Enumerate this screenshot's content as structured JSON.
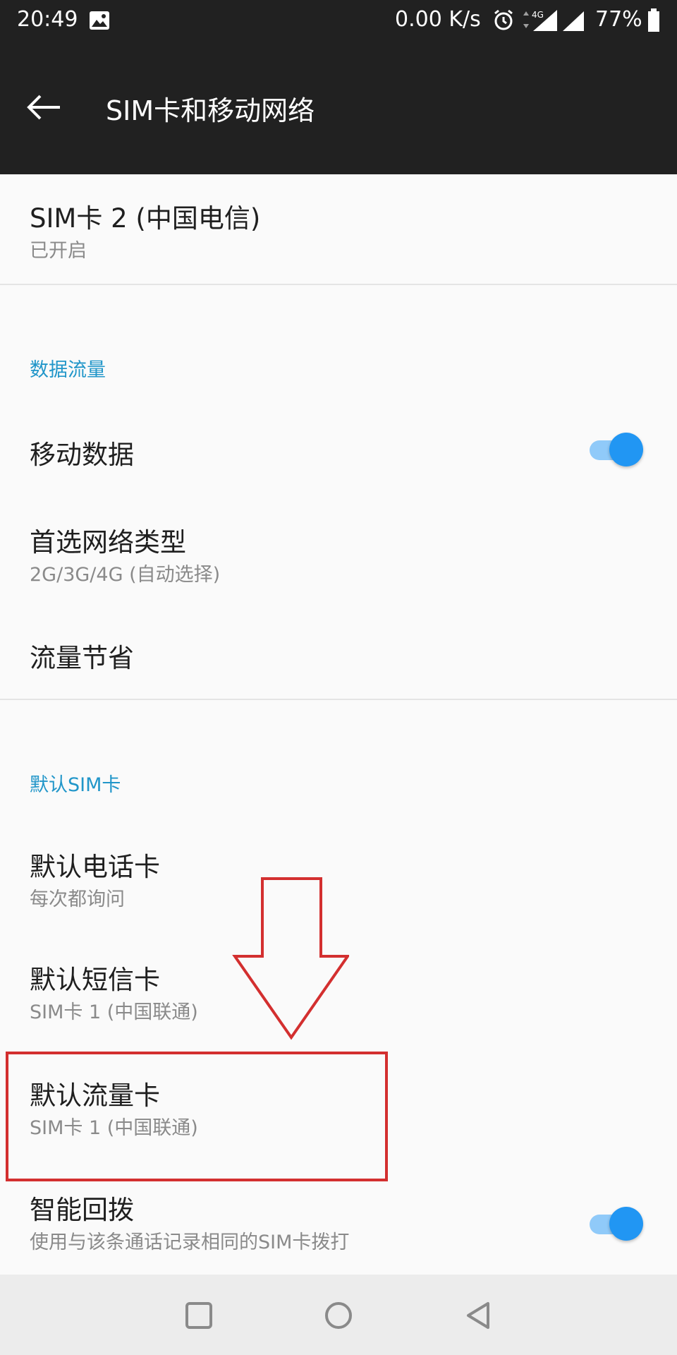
{
  "status_bar": {
    "time": "20:49",
    "speed": "0.00 K/s",
    "network_type": "4G",
    "battery": "77%"
  },
  "toolbar": {
    "title": "SIM卡和移动网络"
  },
  "sim2": {
    "title": "SIM卡 2 (中国电信)",
    "status": "已开启"
  },
  "data_section": {
    "header": "数据流量",
    "mobile_data": {
      "label": "移动数据",
      "enabled": true
    },
    "preferred_network": {
      "label": "首选网络类型",
      "value": "2G/3G/4G (自动选择)"
    },
    "data_saver": {
      "label": "流量节省"
    }
  },
  "default_sim_section": {
    "header": "默认SIM卡",
    "call_card": {
      "label": "默认电话卡",
      "value": "每次都询问"
    },
    "sms_card": {
      "label": "默认短信卡",
      "value": "SIM卡 1 (中国联通)"
    },
    "data_card": {
      "label": "默认流量卡",
      "value": "SIM卡 1 (中国联通)"
    },
    "smart_callback": {
      "label": "智能回拨",
      "description": "使用与该条通话记录相同的SIM卡拨打",
      "enabled": true
    }
  },
  "colors": {
    "toolbar_bg": "#212121",
    "accent": "#2196f3",
    "section_header": "#2196c9",
    "annotation": "#d32f2f"
  }
}
